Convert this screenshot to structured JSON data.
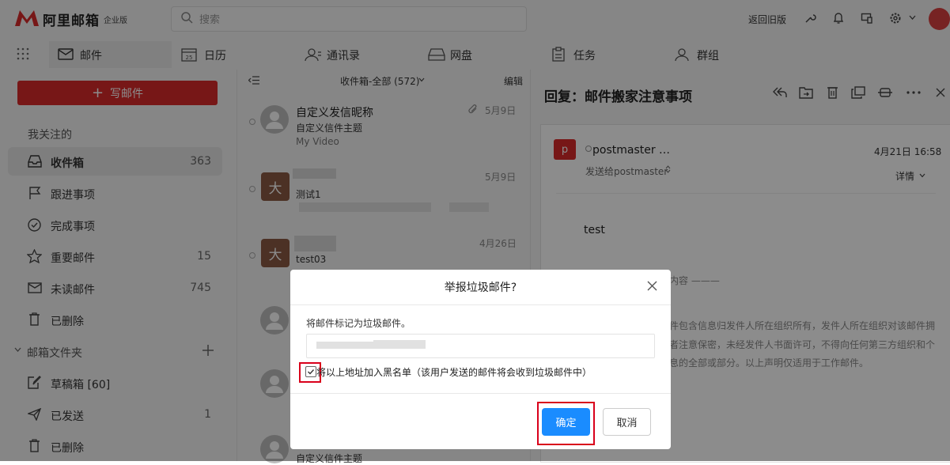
{
  "app": {
    "brand": "阿里邮箱",
    "edition": "企业版"
  },
  "colors": {
    "brand_red": "#d92b2b",
    "primary_blue": "#1a8cff",
    "highlight_red": "#d9001b"
  },
  "search": {
    "placeholder": "搜索"
  },
  "topbar": {
    "old_version": "返回旧版"
  },
  "nav": {
    "tabs": [
      {
        "label": "邮件",
        "icon": "mail-icon"
      },
      {
        "label": "日历",
        "icon": "calendar-icon",
        "icon_text": "25"
      },
      {
        "label": "通讯录",
        "icon": "contacts-icon"
      },
      {
        "label": "网盘",
        "icon": "drive-icon"
      },
      {
        "label": "任务",
        "icon": "task-icon"
      },
      {
        "label": "群组",
        "icon": "group-icon"
      }
    ]
  },
  "sidebar": {
    "compose": "写邮件",
    "follow_header": "我关注的",
    "items": [
      {
        "label": "收件箱",
        "count": "363"
      },
      {
        "label": "跟进事项",
        "count": ""
      },
      {
        "label": "完成事项",
        "count": ""
      },
      {
        "label": "重要邮件",
        "count": "15"
      },
      {
        "label": "未读邮件",
        "count": "745"
      },
      {
        "label": "已删除",
        "count": ""
      }
    ],
    "folders_header": "邮箱文件夹",
    "folders": [
      {
        "label": "草稿箱 [60]",
        "count": ""
      },
      {
        "label": "已发送",
        "count": "1"
      },
      {
        "label": "已删除",
        "count": ""
      }
    ]
  },
  "list": {
    "header": "收件箱-全部 (572)",
    "edit": "编辑",
    "items": [
      {
        "sender": "自定义发信昵称",
        "subject": "自定义信件主题",
        "preview": "My Video",
        "date": "5月9日"
      },
      {
        "sender": "",
        "avatar": "大",
        "subject": "测试1",
        "preview": "",
        "date": "5月9日"
      },
      {
        "sender": "",
        "avatar": "大",
        "subject": "test03",
        "preview": "",
        "date": "4月26日"
      },
      {
        "sender": "",
        "subject": "",
        "preview": "",
        "date": ""
      },
      {
        "sender": "",
        "subject": "",
        "preview": "",
        "date": ""
      },
      {
        "sender": "",
        "subject": "自定义信件主题",
        "preview": "",
        "date": ""
      }
    ]
  },
  "reader": {
    "title": "回复：邮件搬家注意事项",
    "avatar": "p",
    "from": "postmaster …",
    "date": "4月21日 16:58",
    "to": "发送给postmaster",
    "details": "详情",
    "body": "test",
    "divider_text": "内容",
    "disclaimer1": "件包含信息归发件人所在组织所有，发件人所在组织对该邮件拥",
    "disclaimer2": "者注意保密，未经发件人书面许可，不得向任何第三方组织和个",
    "disclaimer3": "息的全部或部分。以上声明仅适用于工作邮件。"
  },
  "dialog": {
    "title": "举报垃圾邮件?",
    "message": "将邮件标记为垃圾邮件。",
    "checkbox_label": "将以上地址加入黑名单（该用户发送的邮件将会收到垃圾邮件中）",
    "checkbox_checked": true,
    "confirm": "确定",
    "cancel": "取消"
  }
}
